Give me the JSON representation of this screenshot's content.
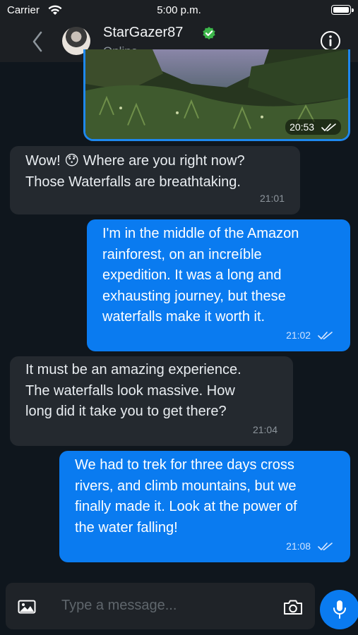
{
  "status_bar": {
    "carrier": "Carrier",
    "time": "5:00 p.m."
  },
  "header": {
    "name": "StarGazer87",
    "status": "Online"
  },
  "messages": [
    {
      "type": "image",
      "direction": "out",
      "time": "20:53"
    },
    {
      "type": "text",
      "direction": "in",
      "lines": [
        "Wow! 😯 Where are you right now?",
        "Those Waterfalls are breathtaking."
      ],
      "time": "21:01"
    },
    {
      "type": "text",
      "direction": "out",
      "lines": [
        "I'm in the middle of the Amazon",
        "rainforest, on an increíble",
        "expedition. It was a long and",
        "exhausting journey, but these",
        "waterfalls make it worth it."
      ],
      "time": "21:02"
    },
    {
      "type": "text",
      "direction": "in",
      "lines": [
        "It must be an amazing experience.",
        "The waterfalls look massive. How",
        "long did it take you to get there?"
      ],
      "time": "21:04"
    },
    {
      "type": "text",
      "direction": "out",
      "lines": [
        "We had to trek for three days cross",
        "rivers, and climb mountains, but we",
        "finally made it. Look at the power of",
        "the water falling!"
      ],
      "time": "21:08"
    }
  ],
  "composer": {
    "placeholder": "Type a message..."
  },
  "colors": {
    "accent": "#0a7bf0",
    "background": "#0f161d",
    "incoming_bubble": "#24292f",
    "verified": "#3cb64a"
  },
  "icons": [
    "wifi-icon",
    "battery-icon",
    "back-chevron-icon",
    "verified-badge-icon",
    "info-icon",
    "double-check-icon",
    "gallery-icon",
    "camera-icon",
    "microphone-icon"
  ]
}
